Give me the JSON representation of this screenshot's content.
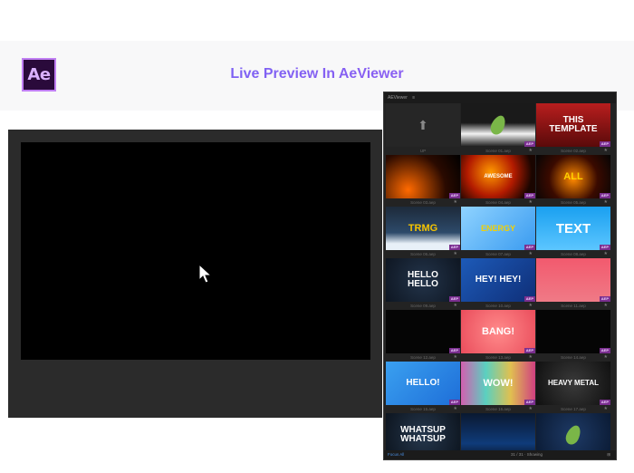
{
  "header": {
    "logo_text": "Ae",
    "title": "Live Preview In AeViewer"
  },
  "panel": {
    "tab_label": "AEViewer",
    "tab_menu": "≡",
    "footer_left": "Focus All",
    "footer_center": "31 / 31 · Showing",
    "footer_right": "⊞"
  },
  "items": [
    {
      "caption": "UP",
      "thumb": "",
      "aep": false,
      "kind": "up"
    },
    {
      "caption": "Scene 01.aep",
      "thumb": "",
      "aep": true,
      "kind": "leaf"
    },
    {
      "caption": "Scene 02.aep",
      "thumb": "THIS TEMPLATE",
      "aep": true,
      "kind": "this"
    },
    {
      "caption": "Scene 03.aep",
      "thumb": "",
      "aep": true,
      "kind": "fire"
    },
    {
      "caption": "Scene 04.aep",
      "thumb": "AWESOME",
      "aep": true,
      "kind": "awesome"
    },
    {
      "caption": "Scene 05.aep",
      "thumb": "ALL",
      "aep": true,
      "kind": "fire2"
    },
    {
      "caption": "Scene 06.aep",
      "thumb": "TRMG",
      "aep": true,
      "kind": "trmg"
    },
    {
      "caption": "Scene 07.aep",
      "thumb": "ENERGY",
      "aep": true,
      "kind": "energy"
    },
    {
      "caption": "Scene 08.aep",
      "thumb": "TEXT",
      "aep": true,
      "kind": "text"
    },
    {
      "caption": "Scene 09.aep",
      "thumb": "HELLO HELLO",
      "aep": true,
      "kind": "hello"
    },
    {
      "caption": "Scene 10.aep",
      "thumb": "HEY! HEY!",
      "aep": true,
      "kind": "hey"
    },
    {
      "caption": "Scene 11.aep",
      "thumb": "",
      "aep": true,
      "kind": "pink"
    },
    {
      "caption": "Scene 12.aep",
      "thumb": "",
      "aep": true,
      "kind": "black"
    },
    {
      "caption": "Scene 13.aep",
      "thumb": "BANG!",
      "aep": true,
      "kind": "bang"
    },
    {
      "caption": "Scene 14.aep",
      "thumb": "",
      "aep": true,
      "kind": "black2"
    },
    {
      "caption": "Scene 15.aep",
      "thumb": "HELLO!",
      "aep": true,
      "kind": "hello2"
    },
    {
      "caption": "Scene 16.aep",
      "thumb": "WOW!",
      "aep": true,
      "kind": "wow"
    },
    {
      "caption": "Scene 17.aep",
      "thumb": "HEAVY METAL",
      "aep": true,
      "kind": "heavy"
    },
    {
      "caption": "",
      "thumb": "WHATSUP WHATSUP",
      "aep": false,
      "kind": "whatsup"
    },
    {
      "caption": "",
      "thumb": "",
      "aep": false,
      "kind": "blueglow"
    },
    {
      "caption": "",
      "thumb": "",
      "aep": false,
      "kind": "leaf2"
    }
  ]
}
